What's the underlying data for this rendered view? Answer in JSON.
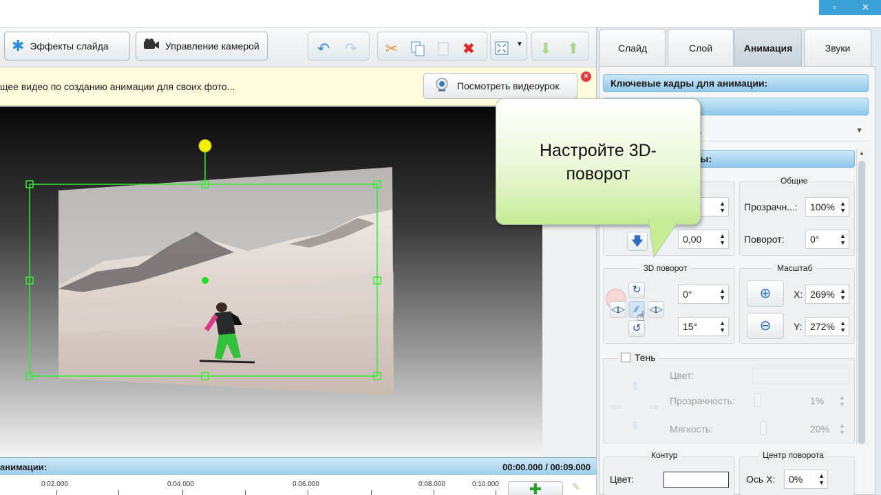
{
  "toolbar": {
    "slide_effects_label": "Эффекты слайда",
    "camera_label": "Управление камерой"
  },
  "hint": {
    "text": "щее видео по созданию анимации для своих фото...",
    "watch_label": "Посмотреть видеоурок"
  },
  "tabs": [
    {
      "label": "Слайд",
      "active": false
    },
    {
      "label": "Слой",
      "active": false
    },
    {
      "label": "Анимация",
      "active": true
    },
    {
      "label": "Звуки",
      "active": false
    }
  ],
  "panel": {
    "keyframes_title": "Ключевые кадры для анимации:",
    "layer_select_partial": "ь",
    "params_title_partial": "ры:",
    "position_x_partial": "0",
    "position_y": "0,00",
    "general": {
      "title": "Общие",
      "opacity_label": "Прозрачн...:",
      "opacity_value": "100%",
      "rotation_label": "Поворот:",
      "rotation_value": "0°"
    },
    "rotate3d": {
      "title": "3D поворот",
      "value_1": "0°",
      "value_2": "15°"
    },
    "scale": {
      "title": "Масштаб",
      "x_label": "X:",
      "x_value": "269%",
      "y_label": "Y:",
      "y_value": "272%"
    },
    "shadow": {
      "label": "Тень",
      "checked": false,
      "color_label": "Цвет:",
      "opacity_label": "Прозрачность:",
      "opacity_value": "1%",
      "softness_label": "Мягкость:",
      "softness_value": "20%"
    },
    "contour": {
      "title": "Контур",
      "color_label": "Цвет:"
    },
    "pivot": {
      "title": "Центр поворота",
      "axis_x_label": "Ось X:",
      "axis_x_value": "0%"
    }
  },
  "callout": {
    "line1": "Настройте 3D-",
    "line2": "поворот"
  },
  "timeline": {
    "title_partial": "анимации:",
    "time": "00:00.000 / 00:09.000",
    "ticks": [
      "0:02.000",
      "0:04.000",
      "0:06.000",
      "0:08.000",
      "0:10.000"
    ]
  },
  "colors": {
    "accent": "#3aa0d8",
    "selection": "#33ee33",
    "handle": "#f0f000"
  }
}
